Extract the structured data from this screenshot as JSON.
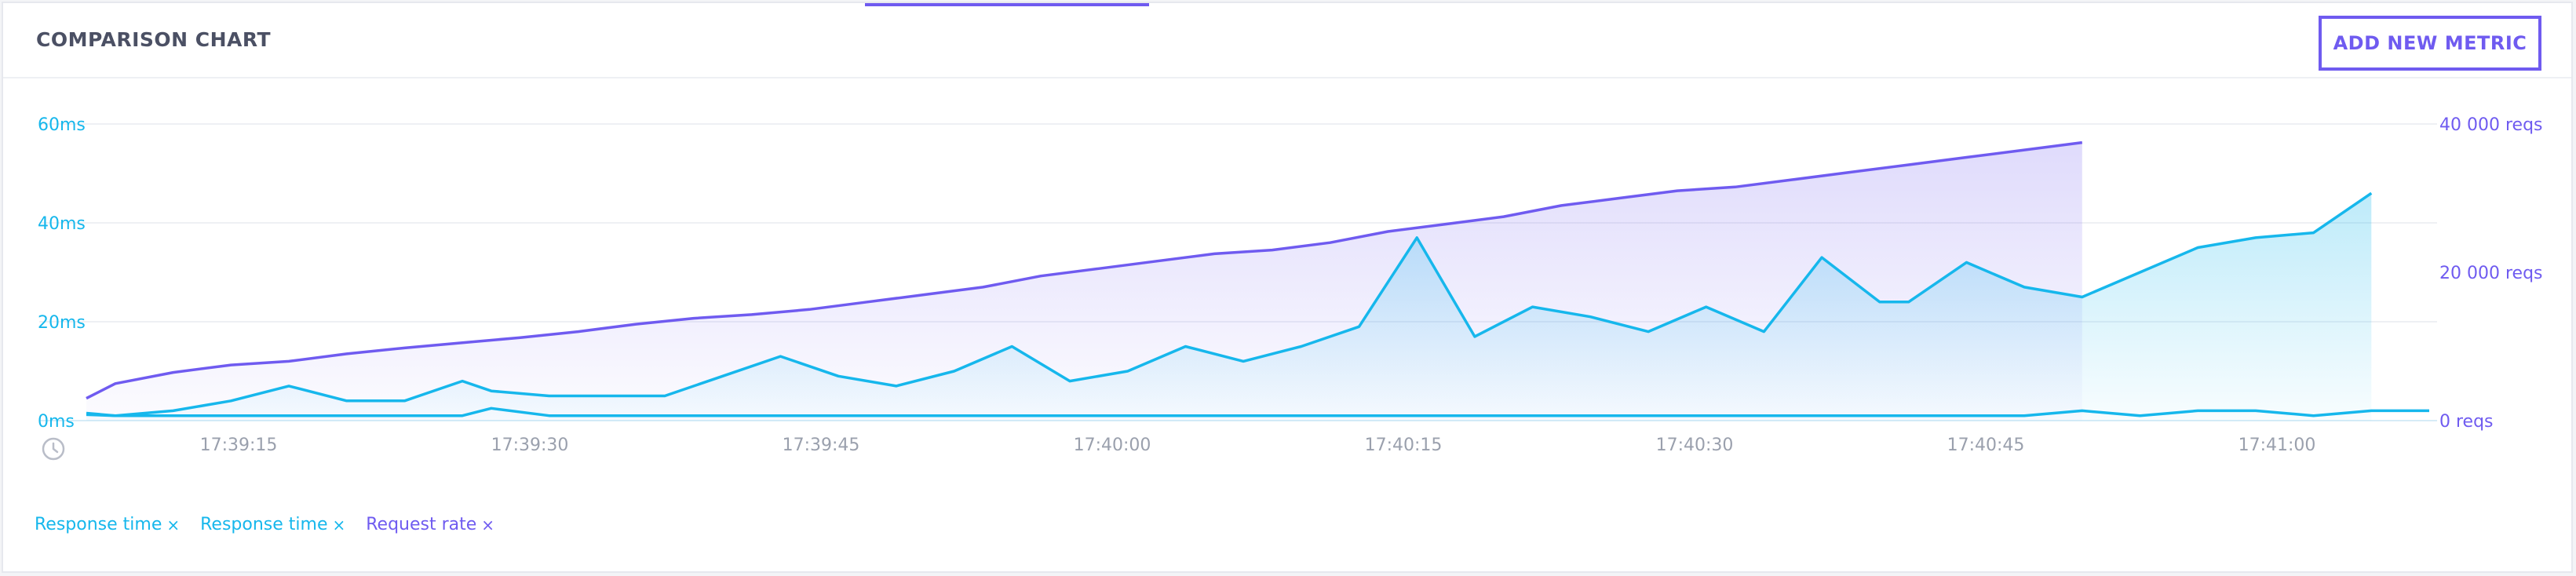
{
  "header": {
    "title": "COMPARISON CHART",
    "add_button_label": "ADD NEW METRIC"
  },
  "colors": {
    "response_time": "#16b7ec",
    "request_rate": "#6f5bf0",
    "axis_text_left": "#16b7ec",
    "axis_text_right": "#6f5bf0",
    "tick_text": "#9aa0ad"
  },
  "chart_data": {
    "type": "line",
    "x": [
      "17:39:05",
      "17:39:06",
      "17:39:08",
      "17:39:10",
      "17:39:12",
      "17:39:14",
      "17:39:16",
      "17:39:18",
      "17:39:20",
      "17:39:22",
      "17:39:24",
      "17:39:26",
      "17:39:28",
      "17:39:30",
      "17:39:32",
      "17:39:34",
      "17:39:36",
      "17:39:38",
      "17:39:40",
      "17:39:42",
      "17:39:44",
      "17:39:46",
      "17:39:48",
      "17:39:50",
      "17:39:52",
      "17:39:54",
      "17:39:56",
      "17:39:58",
      "17:40:00",
      "17:40:02",
      "17:40:04",
      "17:40:06",
      "17:40:08",
      "17:40:10",
      "17:40:12",
      "17:40:14",
      "17:40:16",
      "17:40:18",
      "17:40:20",
      "17:40:22",
      "17:40:24",
      "17:40:26",
      "17:40:28",
      "17:40:30",
      "17:40:32",
      "17:40:34",
      "17:40:36",
      "17:40:38",
      "17:40:40",
      "17:40:42",
      "17:40:44",
      "17:40:46",
      "17:40:48",
      "17:40:50",
      "17:40:52",
      "17:40:54",
      "17:40:56",
      "17:40:58",
      "17:41:00",
      "17:41:02",
      "17:41:04",
      "17:41:06",
      "17:41:08"
    ],
    "x_ticks": [
      "17:39:15",
      "17:39:30",
      "17:39:45",
      "17:40:00",
      "17:40:15",
      "17:40:30",
      "17:40:45",
      "17:41:00"
    ],
    "y_left_ticks": [
      "60ms",
      "40ms",
      "20ms",
      "0ms"
    ],
    "y_right_ticks": [
      "40 000 reqs",
      "20 000 reqs",
      "0 reqs"
    ],
    "y_left_lim": [
      0,
      60
    ],
    "y_right_lim": [
      0,
      40000
    ],
    "series": [
      {
        "name": "Response time",
        "axis": "left",
        "color": "#16b7ec",
        "values": [
          1.5,
          1,
          2,
          4,
          7,
          4,
          4,
          8,
          6,
          5,
          5,
          5,
          9,
          13,
          9,
          7,
          10,
          15,
          8,
          10,
          15,
          12,
          15,
          19,
          37,
          17,
          23,
          21,
          18,
          23,
          18,
          33,
          24,
          24,
          32,
          27,
          25,
          30,
          35,
          37,
          38,
          46,
          null,
          null,
          null,
          null,
          null,
          null,
          null,
          null,
          null,
          null,
          null,
          null,
          null,
          null,
          null,
          null,
          null,
          null,
          null,
          null,
          null
        ],
        "x_index": [
          0,
          1,
          3,
          5,
          7,
          9,
          11,
          13,
          14,
          16,
          18,
          20,
          22,
          24,
          26,
          28,
          30,
          32,
          34,
          36,
          38,
          40,
          42,
          44,
          46,
          48,
          50,
          52,
          54,
          56,
          58,
          60,
          62,
          63,
          65,
          67,
          69,
          71,
          73,
          75,
          77,
          79
        ]
      },
      {
        "name": "Response time",
        "axis": "left",
        "color": "#16b7ec",
        "values": [
          1.2,
          1,
          1,
          1,
          1,
          1,
          1,
          1,
          2.5,
          1,
          1,
          1,
          1,
          1,
          1,
          1,
          1,
          1,
          1,
          1,
          1,
          1,
          1,
          1,
          1,
          1,
          1,
          1,
          1,
          1,
          1,
          1,
          1,
          1,
          1,
          1,
          2,
          1,
          2,
          2,
          1,
          2,
          2,
          2
        ],
        "x_index": [
          0,
          1,
          3,
          5,
          7,
          9,
          11,
          13,
          14,
          16,
          18,
          20,
          22,
          24,
          26,
          28,
          30,
          32,
          34,
          36,
          38,
          40,
          42,
          44,
          46,
          48,
          50,
          52,
          54,
          56,
          58,
          60,
          62,
          63,
          65,
          67,
          69,
          71,
          73,
          75,
          77,
          79,
          80,
          81
        ]
      },
      {
        "name": "Request rate",
        "axis": "right",
        "color": "#6f5bf0",
        "values": [
          3000,
          5000,
          6500,
          7500,
          8000,
          9000,
          9800,
          10500,
          11200,
          12000,
          13000,
          13800,
          14300,
          15000,
          16000,
          17000,
          18000,
          19500,
          20500,
          21500,
          22500,
          23000,
          24000,
          25500,
          26500,
          27500,
          29000,
          30000,
          31000,
          31500,
          32500,
          33500,
          34500,
          35500,
          36500,
          37500
        ],
        "x_index": [
          0,
          1,
          3,
          5,
          7,
          9,
          11,
          13,
          15,
          17,
          19,
          21,
          23,
          25,
          27,
          29,
          31,
          33,
          35,
          37,
          39,
          41,
          43,
          45,
          47,
          49,
          51,
          53,
          55,
          57,
          59,
          61,
          63,
          65,
          67,
          69
        ]
      }
    ]
  },
  "legend": [
    {
      "label": "Response time",
      "color": "#16b7ec",
      "remove": "×"
    },
    {
      "label": "Response time",
      "color": "#16b7ec",
      "remove": "×"
    },
    {
      "label": "Request rate",
      "color": "#6f5bf0",
      "remove": "×"
    }
  ]
}
